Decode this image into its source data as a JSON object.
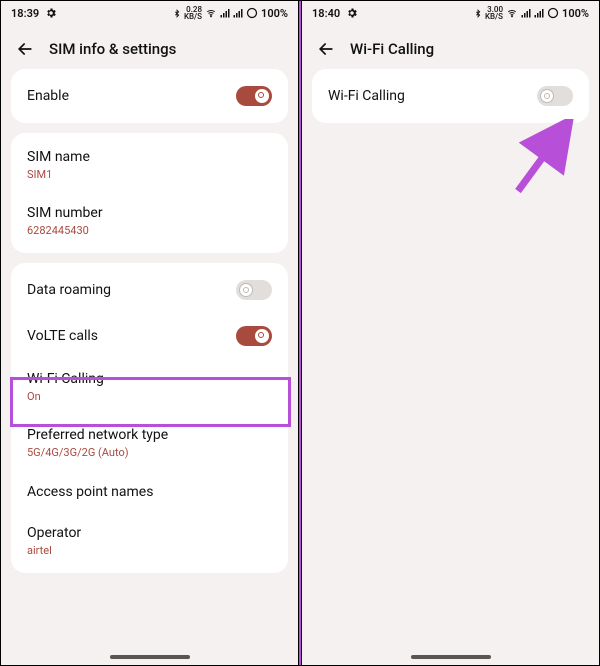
{
  "left": {
    "status": {
      "time": "18:39",
      "speed_top": "0.28",
      "speed_unit": "KB/S",
      "battery": "100%"
    },
    "header": "SIM info & settings",
    "enable": {
      "label": "Enable",
      "on": true
    },
    "sim_name": {
      "label": "SIM name",
      "value": "SIM1"
    },
    "sim_number": {
      "label": "SIM number",
      "value": "6282445430"
    },
    "data_roaming": {
      "label": "Data roaming",
      "on": false
    },
    "volte": {
      "label": "VoLTE calls",
      "on": true
    },
    "wifi_calling": {
      "label": "Wi-Fi Calling",
      "value": "On"
    },
    "pref_net": {
      "label": "Preferred network type",
      "value": "5G/4G/3G/2G (Auto)"
    },
    "apn": {
      "label": "Access point names"
    },
    "operator": {
      "label": "Operator",
      "value": "airtel"
    }
  },
  "right": {
    "status": {
      "time": "18:40",
      "speed_top": "3.00",
      "speed_unit": "KB/S",
      "battery": "100%"
    },
    "header": "Wi-Fi Calling",
    "wifi_calling": {
      "label": "Wi-Fi Calling",
      "on": false
    }
  }
}
